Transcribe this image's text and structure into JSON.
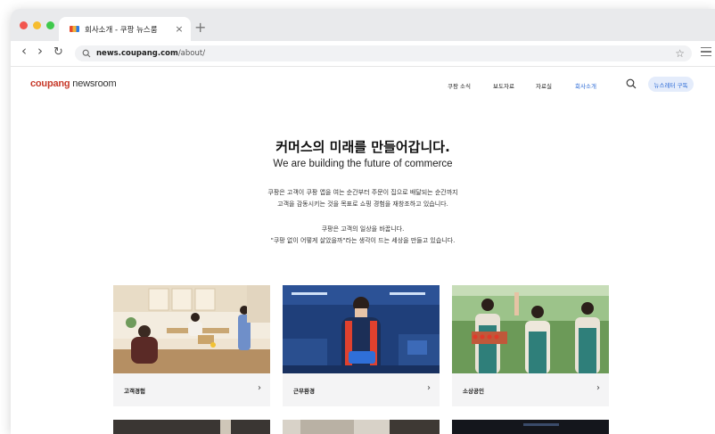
{
  "browser": {
    "tab_title": "회사소개 - 쿠팡 뉴스룸",
    "tab_close": "×",
    "new_tab": "+",
    "back": "‹",
    "forward": "›",
    "reload": "↻",
    "url_host": "news.coupang.com",
    "url_path": "/about/",
    "bookmark": "☆"
  },
  "site": {
    "logo_brand": "coupang",
    "logo_rest": " newsroom",
    "nav": [
      {
        "label": "쿠팡 소식"
      },
      {
        "label": "보도자료"
      },
      {
        "label": "자료실"
      },
      {
        "label": "회사소개"
      }
    ],
    "subscribe_label": "뉴스레터 구독"
  },
  "hero": {
    "title": "커머스의 미래를 만들어갑니다.",
    "subtitle": "We are building the future of commerce",
    "para1_line1": "쿠팡은 고객이 쿠팡 앱을 여는 순간부터 주문이 집으로 배달되는 순간까지",
    "para1_line2": "고객을 감동시키는 것을 목표로 쇼핑 경험을 재창조하고 있습니다.",
    "para2_line1": "쿠팡은 고객의 일상을 바꿉니다.",
    "para2_line2": "\"쿠팡 없이 어떻게 살았을까\"라는 생각이 드는 세상을 만들고 있습니다."
  },
  "cards": [
    {
      "label": "고객경험",
      "chevron": "›"
    },
    {
      "label": "근무환경",
      "chevron": "›"
    },
    {
      "label": "소상공인",
      "chevron": "›"
    }
  ],
  "colors": {
    "accent": "#2d6bd6",
    "logo_red": "#c73a2a"
  }
}
